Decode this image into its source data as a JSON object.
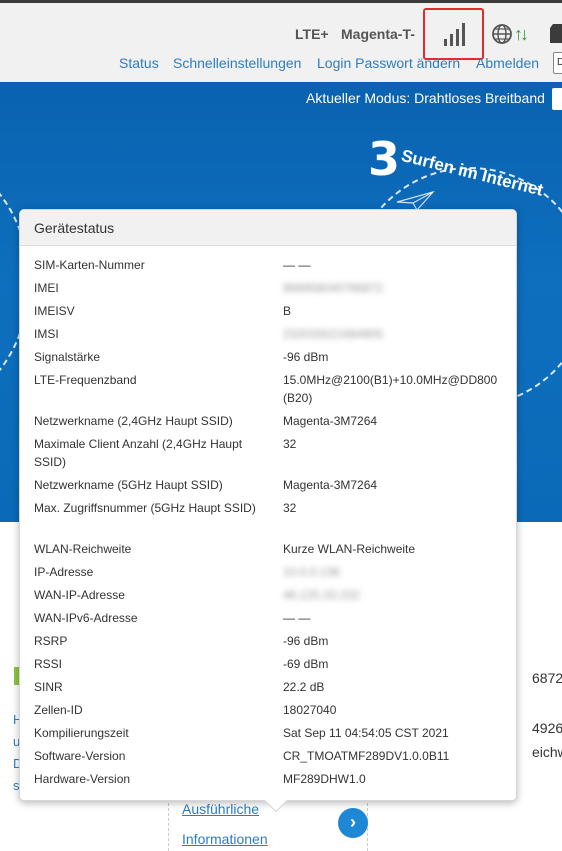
{
  "header": {
    "network_type": "LTE+",
    "provider": "Magenta-T-",
    "signal_level": "4/4",
    "nav": [
      "Status",
      "Schnelleinstellungen",
      "Login Passwort ändern",
      "Abmelden"
    ]
  },
  "banner": {
    "mode_label": "Aktueller Modus: Drahtloses Breitband",
    "step_number": "3",
    "step_text": "Surfen im Internet"
  },
  "content": {
    "left_chars": [
      "H",
      "u",
      "D",
      "s"
    ],
    "right_values": [
      "6872",
      "4926",
      "eichwe"
    ],
    "more_link_line1": "Ausführliche",
    "more_link_line2": "Informationen",
    "go_icon": "›"
  },
  "popup": {
    "title": "Gerätestatus",
    "rows": [
      {
        "key": "SIM-Karten-Nummer",
        "value": "— —",
        "blurred": false
      },
      {
        "key": "IMEI",
        "value": "866958040766872",
        "blurred": true
      },
      {
        "key": "IMEISV",
        "value": "B",
        "blurred": false
      },
      {
        "key": "IMSI",
        "value": "232033021684805",
        "blurred": true
      },
      {
        "key": "Signalstärke",
        "value": "-96 dBm",
        "blurred": false
      },
      {
        "key": "LTE-Frequenzband",
        "value": "15.0MHz@2100(B1)+10.0MHz@DD800 (B20)",
        "blurred": false
      },
      {
        "key": "Netzwerkname (2,4GHz Haupt SSID)",
        "value": "Magenta-3M7264",
        "blurred": false
      },
      {
        "key": "Maximale Client Anzahl (2,4GHz Haupt SSID)",
        "value": "32",
        "blurred": false
      },
      {
        "key": "Netzwerkname (5GHz Haupt SSID)",
        "value": "Magenta-3M7264",
        "blurred": false
      },
      {
        "key": "Max. Zugriffsnummer (5GHz Haupt SSID)",
        "value": "32",
        "blurred": false
      },
      {
        "key": "WLAN-Reichweite",
        "value": "Kurze WLAN-Reichweite",
        "blurred": false
      },
      {
        "key": "IP-Adresse",
        "value": "10.0.0.138",
        "blurred": true
      },
      {
        "key": "WAN-IP-Adresse",
        "value": "46.125.33.232",
        "blurred": true
      },
      {
        "key": "WAN-IPv6-Adresse",
        "value": "— —",
        "blurred": false
      },
      {
        "key": "RSRP",
        "value": "-96 dBm",
        "blurred": false
      },
      {
        "key": "RSSI",
        "value": "-69 dBm",
        "blurred": false
      },
      {
        "key": "SINR",
        "value": "22.2 dB",
        "blurred": false
      },
      {
        "key": "Zellen-ID",
        "value": "18027040",
        "blurred": false
      },
      {
        "key": "Kompilierungszeit",
        "value": "Sat Sep 11 04:54:05 CST 2021",
        "blurred": false
      },
      {
        "key": "Software-Version",
        "value": "CR_TMOATMF289DV1.0.0B11",
        "blurred": false
      },
      {
        "key": "Hardware-Version",
        "value": "MF289DHW1.0",
        "blurred": false
      }
    ]
  },
  "colors": {
    "link": "#2e7dc1",
    "banner": "#0d6fbe",
    "highlight_border": "#e32b2b",
    "accent_green": "#8cc63f"
  }
}
